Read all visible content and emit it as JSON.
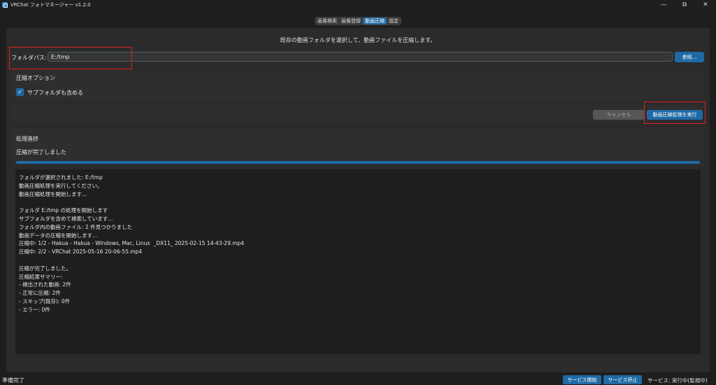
{
  "window": {
    "title": "VRChat フォトマネージャー v1.2.0",
    "minimize": "—",
    "maximize": "⧉",
    "close": "✕"
  },
  "tabs": [
    {
      "label": "画像検索",
      "active": false
    },
    {
      "label": "画像登録",
      "active": false
    },
    {
      "label": "動画圧縮",
      "active": true
    },
    {
      "label": "設定",
      "active": false
    }
  ],
  "description": "既存の動画フォルダを選択して、動画ファイルを圧縮します。",
  "folder": {
    "label": "フォルダパス:",
    "value": "E:/tmp",
    "browse_label": "参照..."
  },
  "options": {
    "title": "圧縮オプション",
    "include_subfolders_label": "サブフォルダも含める",
    "include_subfolders_checked": true,
    "check_glyph": "✓"
  },
  "actions": {
    "cancel_label": "キャンセル",
    "run_label": "動画圧縮処理を実行"
  },
  "progress": {
    "title": "処理進捗",
    "status": "圧縮が完了しました",
    "fraction": 1.0
  },
  "log": {
    "lines": [
      "フォルダが選択されました: E:/tmp",
      "動画圧縮処理を実行してください。",
      "動画圧縮処理を開始します...",
      "",
      "フォルダ E:/tmp の処理を開始します",
      "サブフォルダを含めて検索しています...",
      "フォルダ内の動画ファイル: 2 件見つかりました",
      "動画データの圧縮を開始します...",
      "圧縮中: 1/2 - Hakua - Hakua - Windows, Mac, Linux  _DX11_ 2025-02-15 14-43-29.mp4",
      "圧縮中: 2/2 - VRChat 2025-05-16 20-06-55.mp4",
      "",
      "圧縮が完了しました。",
      "圧縮結果サマリー:",
      "- 検出された動画: 2件",
      "- 正常に圧縮: 2件",
      "- スキップ(既存): 0件",
      "- エラー: 0件"
    ]
  },
  "statusbar": {
    "left": "準備完了",
    "service_start_label": "サービス開始",
    "service_stop_label": "サービス停止",
    "service_status": "サービス: 実行中(監視中)"
  },
  "colors": {
    "accent": "#1f6aa5",
    "highlight": "#e02020",
    "background": "#1e1e1e",
    "panel": "#2b2b2b"
  }
}
